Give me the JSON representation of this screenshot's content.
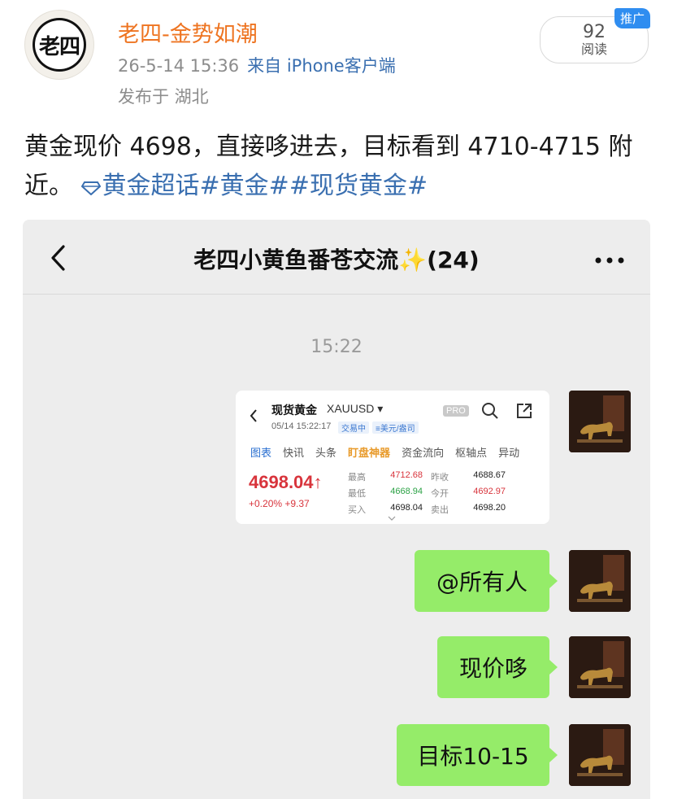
{
  "post": {
    "avatar_text": "老四",
    "username": "老四-金势如潮",
    "datetime": "26-5-14 15:36",
    "source": "来自 iPhone客户端",
    "location": "发布于 湖北",
    "read_count": "92",
    "read_label": "阅读",
    "promo_badge": "推广",
    "text_main": "黄金现价 4698，直接哆进去，目标看到 4710-4715 附近。",
    "topic_links": "黄金超话#黄金##现货黄金#"
  },
  "chat": {
    "title": "老四小黄鱼番苍交流✨(24)",
    "time": "15:22",
    "messages": [
      "@所有人",
      "现价哆",
      "目标10-15"
    ]
  },
  "quote_card": {
    "name": "现货黄金",
    "code": "XAUUSD ▾",
    "date": "05/14 15:22:17",
    "status_tag": "交易中",
    "currency_tag": "≡美元/盎司",
    "pro": "PRO",
    "tabs": [
      "图表",
      "快讯",
      "头条",
      "盯盘神器",
      "资金流向",
      "枢轴点",
      "异动"
    ],
    "price": "4698.04↑",
    "change": "+0.20%  +9.37",
    "stats": [
      [
        "最高",
        "4712.68",
        "昨收",
        "4688.67"
      ],
      [
        "最低",
        "4668.94",
        "今开",
        "4692.97"
      ],
      [
        "买入",
        "4698.04",
        "卖出",
        "4698.20"
      ]
    ]
  },
  "colors": {
    "username": "#ee7421",
    "link": "#3a6fb0",
    "bubble": "#95ec69",
    "price_up": "#d8343c",
    "price_down": "#2ba245"
  }
}
